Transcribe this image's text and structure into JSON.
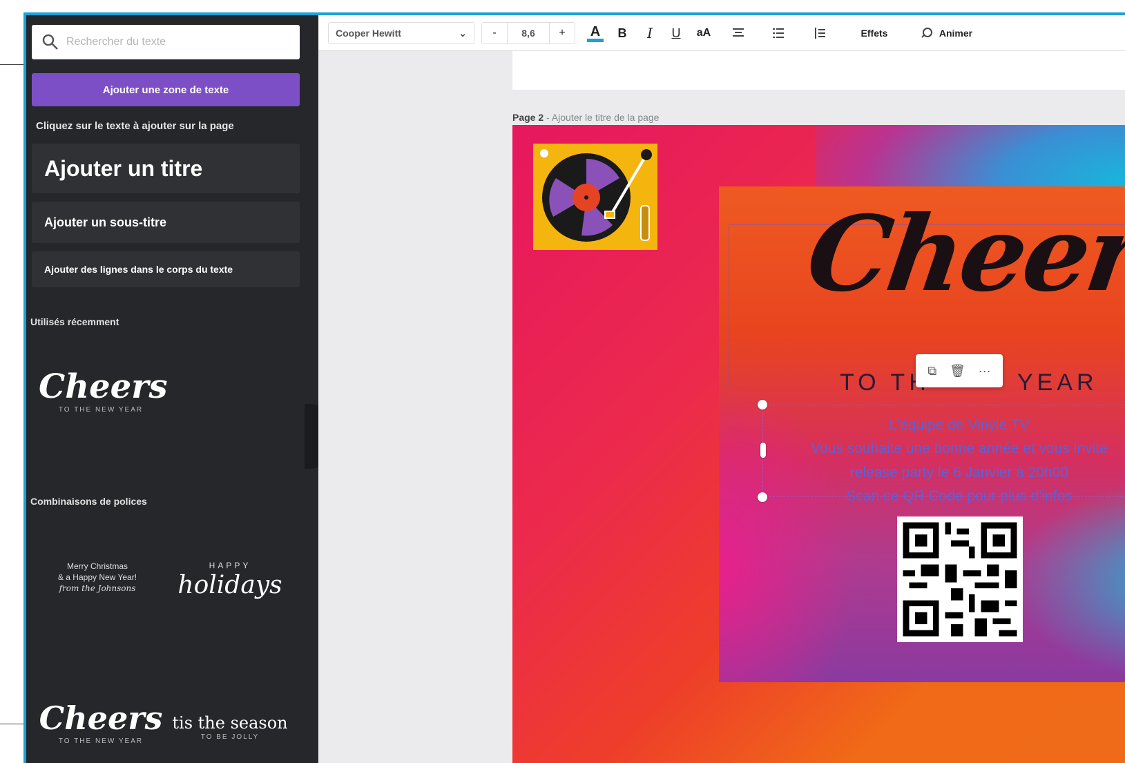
{
  "sidebar": {
    "search_placeholder": "Rechercher du texte",
    "add_text_box": "Ajouter une zone de texte",
    "hint": "Cliquez sur le texte à ajouter sur la page",
    "add_title": "Ajouter un titre",
    "add_subtitle": "Ajouter un sous-titre",
    "add_body": "Ajouter des lignes dans le corps du texte",
    "recent_heading": "Utilisés récemment",
    "combos_heading": "Combinaisons de polices",
    "recent_item": {
      "big": "Cheers",
      "small": "TO THE NEW YEAR"
    },
    "combo_christmas": {
      "line1": "Merry Christmas",
      "line2": "& a Happy New Year!",
      "line3": "from the Johnsons"
    },
    "combo_holidays": {
      "small": "HAPPY",
      "big": "holidays"
    },
    "combo_cheers": {
      "big": "Cheers",
      "small": "TO THE NEW YEAR"
    },
    "combo_season": {
      "big": "tis the season",
      "small": "TO BE JOLLY"
    }
  },
  "toolbar": {
    "font": "Cooper Hewitt",
    "minus": "-",
    "size": "8,6",
    "plus": "+",
    "color_glyph": "A",
    "bold": "B",
    "italic": "I",
    "underline": "U",
    "case": "aA",
    "effects": "Effets",
    "animate": "Animer"
  },
  "page_label": {
    "page": "Page 2",
    "add_title": " - Ajouter le titre de la page"
  },
  "design": {
    "headline": "Cheers",
    "subtitle_start": "TO TH",
    "subtitle_end": "YEAR",
    "body_lines": [
      "L'équipe de Vinyle TV",
      "Vous souhaite une bonne année et vous invite",
      "release party le 6 Janvier à 20h00",
      "Scan ce QR Code pour plus d'infos"
    ]
  },
  "colors": {
    "sidebar_bg": "#26272b",
    "accent_purple": "#7d4fc7",
    "frame_blue": "#1ba1d6",
    "body_text": "#5b62d8"
  },
  "icons": [
    "search-icon",
    "chevron-down-icon",
    "text-color-icon",
    "align-icon",
    "list-icon",
    "spacing-icon",
    "animate-icon",
    "copy-icon",
    "trash-icon",
    "more-icon",
    "turntable-icon",
    "qr-code"
  ]
}
